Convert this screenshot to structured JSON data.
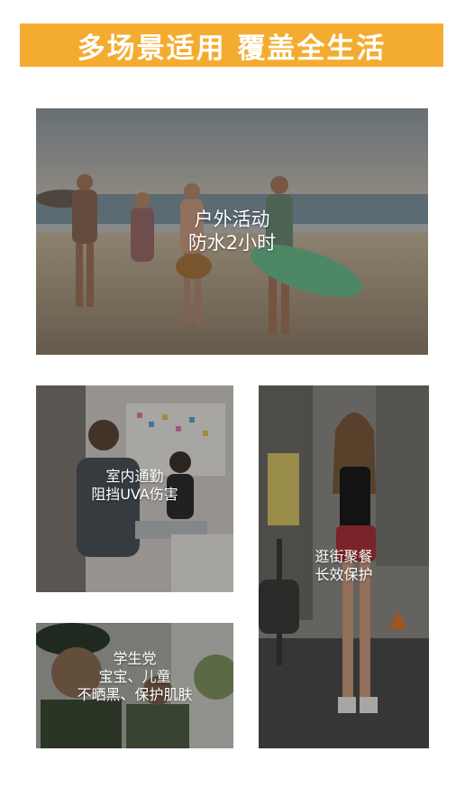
{
  "banner": {
    "title": "多场景适用 覆盖全生活"
  },
  "scenes": {
    "outdoor": {
      "line1": "户外活动",
      "line2": "防水2小时"
    },
    "office": {
      "line1": "室内通勤",
      "line2": "阻挡UVA伤害"
    },
    "street": {
      "line1": "逛街聚餐",
      "line2": "长效保护"
    },
    "student": {
      "line1": "学生党",
      "line2": "宝宝、儿童",
      "line3": "不晒黑、保护肌肤"
    }
  },
  "colors": {
    "banner": "#f4ac30",
    "caption": "#ffffff"
  }
}
